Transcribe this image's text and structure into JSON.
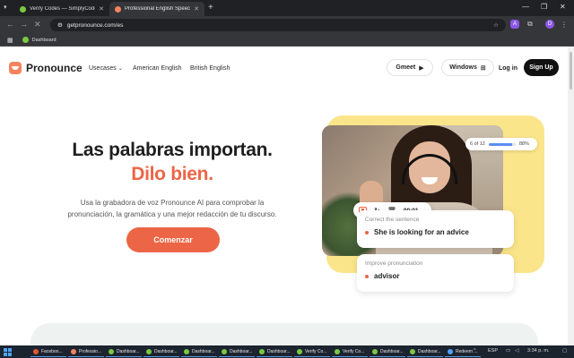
{
  "browser": {
    "tabs": [
      {
        "title": "Verify Codes — SimplyCodes",
        "active": false,
        "color": "#7ac943"
      },
      {
        "title": "Professional English Speech Ch",
        "active": true,
        "color": "#f4845f"
      }
    ],
    "new_tab": "+",
    "url": "getpronounce.com/es",
    "bookmarks": [
      {
        "label": "Dashboard"
      }
    ],
    "extension_label": "A",
    "profile_label": "D"
  },
  "site": {
    "logo": "Pronounce",
    "nav": {
      "usecases": "Usecases",
      "american": "American English",
      "british": "British English",
      "gmeet": "Gmeet",
      "windows": "Windows",
      "login": "Log in",
      "signup": "Sign Up"
    },
    "hero": {
      "title": "Las palabras importan.",
      "title_accent": "Dilo bien.",
      "subtitle_line1": "Usa la grabadora de voz Pronounce AI para comprobar la",
      "subtitle_line2": "pronunciación, la gramática y una mejor redacción de tu discurso.",
      "cta": "Comenzar"
    },
    "visual": {
      "progress_label": "6 of 12",
      "progress_fraction": 0.88,
      "progress_percent": "88%",
      "timer": "00:01",
      "card1_label": "Correct the sentence",
      "card1_text": "She is looking for an advice",
      "card2_label": "Improve pronunciation",
      "card2_text": "advisor"
    },
    "colors": {
      "accent": "#ec6546",
      "yellow": "#fbe58b"
    }
  },
  "taskbar": {
    "items": [
      {
        "label": "Faceboo...",
        "color": "#e4572e"
      },
      {
        "label": "Professio...",
        "color": "#f4845f"
      },
      {
        "label": "Dashboar...",
        "color": "#7ac943"
      },
      {
        "label": "Dashboar...",
        "color": "#7ac943"
      },
      {
        "label": "Dashboar...",
        "color": "#7ac943"
      },
      {
        "label": "Dashboar...",
        "color": "#7ac943"
      },
      {
        "label": "Dashboar...",
        "color": "#7ac943"
      },
      {
        "label": "Verify Co...",
        "color": "#7ac943"
      },
      {
        "label": "Verify Co...",
        "color": "#7ac943"
      },
      {
        "label": "Dashboar...",
        "color": "#7ac943"
      },
      {
        "label": "Dashboar...",
        "color": "#7ac943"
      },
      {
        "label": "Redeem ...",
        "color": "#4da3ff"
      }
    ],
    "language": "ESP",
    "time": "3:34 p. m."
  }
}
